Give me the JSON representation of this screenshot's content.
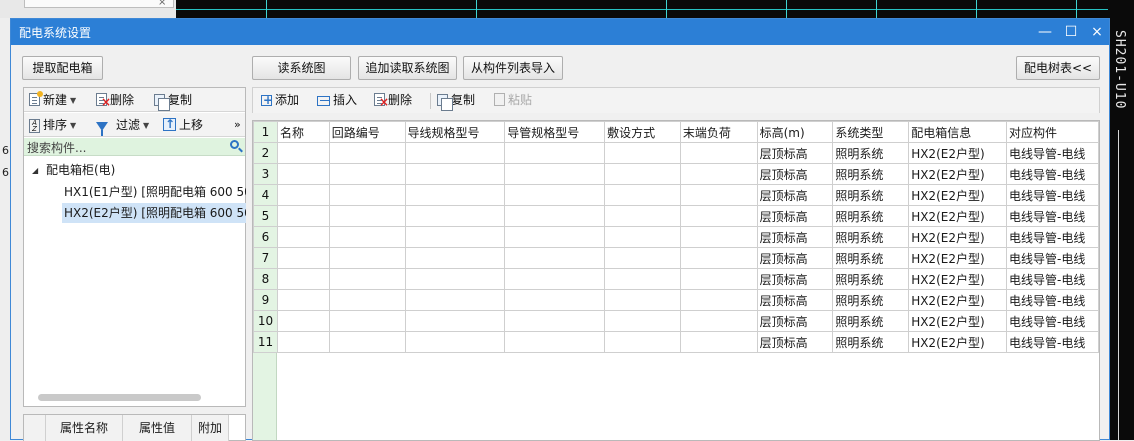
{
  "dialog": {
    "title": "配电系统设置",
    "window_controls": {
      "minimize": "—",
      "maximize": "☐",
      "close": "×"
    }
  },
  "top_buttons": {
    "extract": "提取配电箱",
    "read_diagram": "读系统图",
    "append_read": "追加读取系统图",
    "import_list": "从构件列表导入",
    "tree_toggle": "配电树表<<"
  },
  "left_toolbar": {
    "new": "新建",
    "delete": "删除",
    "copy": "复制",
    "sort": "排序",
    "filter": "过滤",
    "move_up": "上移",
    "more": "»"
  },
  "search": {
    "placeholder": "搜索构件..."
  },
  "tree": {
    "root": "配电箱柜(电)",
    "items": [
      "HX1(E1户型) [照明配电箱 600 50",
      "HX2(E2户型) [照明配电箱 600 50"
    ],
    "selected_index": 1
  },
  "props_header": [
    "属性名称",
    "属性值",
    "附加"
  ],
  "right_toolbar": {
    "add": "添加",
    "insert": "插入",
    "delete": "删除",
    "copy": "复制",
    "paste": "粘贴"
  },
  "table": {
    "header_row_number": "1",
    "columns": [
      "名称",
      "回路编号",
      "导线规格型号",
      "导管规格型号",
      "敷设方式",
      "末端负荷",
      "标高(m)",
      "系统类型",
      "配电箱信息",
      "对应构件"
    ],
    "rows": [
      {
        "n": "2",
        "cells": [
          "",
          "",
          "",
          "",
          "",
          "",
          "层顶标高",
          "照明系统",
          "HX2(E2户型)",
          "电线导管-电线"
        ]
      },
      {
        "n": "3",
        "cells": [
          "",
          "",
          "",
          "",
          "",
          "",
          "层顶标高",
          "照明系统",
          "HX2(E2户型)",
          "电线导管-电线"
        ]
      },
      {
        "n": "4",
        "cells": [
          "",
          "",
          "",
          "",
          "",
          "",
          "层顶标高",
          "照明系统",
          "HX2(E2户型)",
          "电线导管-电线"
        ]
      },
      {
        "n": "5",
        "cells": [
          "",
          "",
          "",
          "",
          "",
          "",
          "层顶标高",
          "照明系统",
          "HX2(E2户型)",
          "电线导管-电线"
        ]
      },
      {
        "n": "6",
        "cells": [
          "",
          "",
          "",
          "",
          "",
          "",
          "层顶标高",
          "照明系统",
          "HX2(E2户型)",
          "电线导管-电线"
        ]
      },
      {
        "n": "7",
        "cells": [
          "",
          "",
          "",
          "",
          "",
          "",
          "层顶标高",
          "照明系统",
          "HX2(E2户型)",
          "电线导管-电线"
        ]
      },
      {
        "n": "8",
        "cells": [
          "",
          "",
          "",
          "",
          "",
          "",
          "层顶标高",
          "照明系统",
          "HX2(E2户型)",
          "电线导管-电线"
        ]
      },
      {
        "n": "9",
        "cells": [
          "",
          "",
          "",
          "",
          "",
          "",
          "层顶标高",
          "照明系统",
          "HX2(E2户型)",
          "电线导管-电线"
        ]
      },
      {
        "n": "10",
        "cells": [
          "",
          "",
          "",
          "",
          "",
          "",
          "层顶标高",
          "照明系统",
          "HX2(E2户型)",
          "电线导管-电线"
        ]
      },
      {
        "n": "11",
        "cells": [
          "",
          "",
          "",
          "",
          "",
          "",
          "层顶标高",
          "照明系统",
          "HX2(E2户型)",
          "电线导管-电线"
        ]
      }
    ]
  },
  "background": {
    "cad_vertical_text": "SH201-U10",
    "left_edge_glyphs": [
      "6",
      "6"
    ]
  },
  "colors": {
    "title_bar": "#2c7fd6",
    "row_header": "#e3f4e3",
    "search_bg": "#dff3df",
    "selection": "#cfe3f7"
  }
}
